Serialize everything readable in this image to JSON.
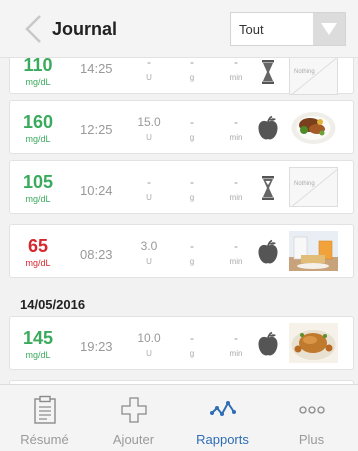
{
  "header": {
    "title": "Journal",
    "filter_value": "Tout",
    "back_icon": "chevron-left-icon",
    "filter_icon": "chevron-down-icon"
  },
  "entries": [
    {
      "glucose": "110",
      "glucose_unit": "mg/dL",
      "glucose_color": "green",
      "time": "14:25",
      "insulin": "-",
      "insulin_unit": "U",
      "carbs": "-",
      "carbs_unit": "g",
      "activity": "-",
      "activity_unit": "min",
      "icon": "hourglass-icon",
      "photo": "none",
      "photo_text": "Nothing"
    },
    {
      "glucose": "160",
      "glucose_unit": "mg/dL",
      "glucose_color": "green",
      "time": "12:25",
      "insulin": "15.0",
      "insulin_unit": "U",
      "carbs": "-",
      "carbs_unit": "g",
      "activity": "-",
      "activity_unit": "min",
      "icon": "apple-icon",
      "photo": "meal-plate"
    },
    {
      "glucose": "105",
      "glucose_unit": "mg/dL",
      "glucose_color": "green",
      "time": "10:24",
      "insulin": "-",
      "insulin_unit": "U",
      "carbs": "-",
      "carbs_unit": "g",
      "activity": "-",
      "activity_unit": "min",
      "icon": "hourglass-icon",
      "photo": "none",
      "photo_text": "Nothing"
    },
    {
      "glucose": "65",
      "glucose_unit": "mg/dL",
      "glucose_color": "red",
      "time": "08:23",
      "insulin": "3.0",
      "insulin_unit": "U",
      "carbs": "-",
      "carbs_unit": "g",
      "activity": "-",
      "activity_unit": "min",
      "icon": "apple-icon",
      "photo": "breakfast"
    },
    {
      "glucose": "145",
      "glucose_unit": "mg/dL",
      "glucose_color": "green",
      "time": "19:23",
      "insulin": "10.0",
      "insulin_unit": "U",
      "carbs": "-",
      "carbs_unit": "g",
      "activity": "-",
      "activity_unit": "min",
      "icon": "apple-icon",
      "photo": "roast-chicken"
    }
  ],
  "date_separator": "14/05/2016",
  "tabs": [
    {
      "label": "Résumé",
      "icon": "clipboard-icon",
      "active": false
    },
    {
      "label": "Ajouter",
      "icon": "plus-icon",
      "active": false
    },
    {
      "label": "Rapports",
      "icon": "chart-line-icon",
      "active": true
    },
    {
      "label": "Plus",
      "icon": "more-dots-icon",
      "active": false
    }
  ],
  "colors": {
    "green": "#3aaa5c",
    "red": "#d6272f",
    "accent": "#2f6db5"
  }
}
